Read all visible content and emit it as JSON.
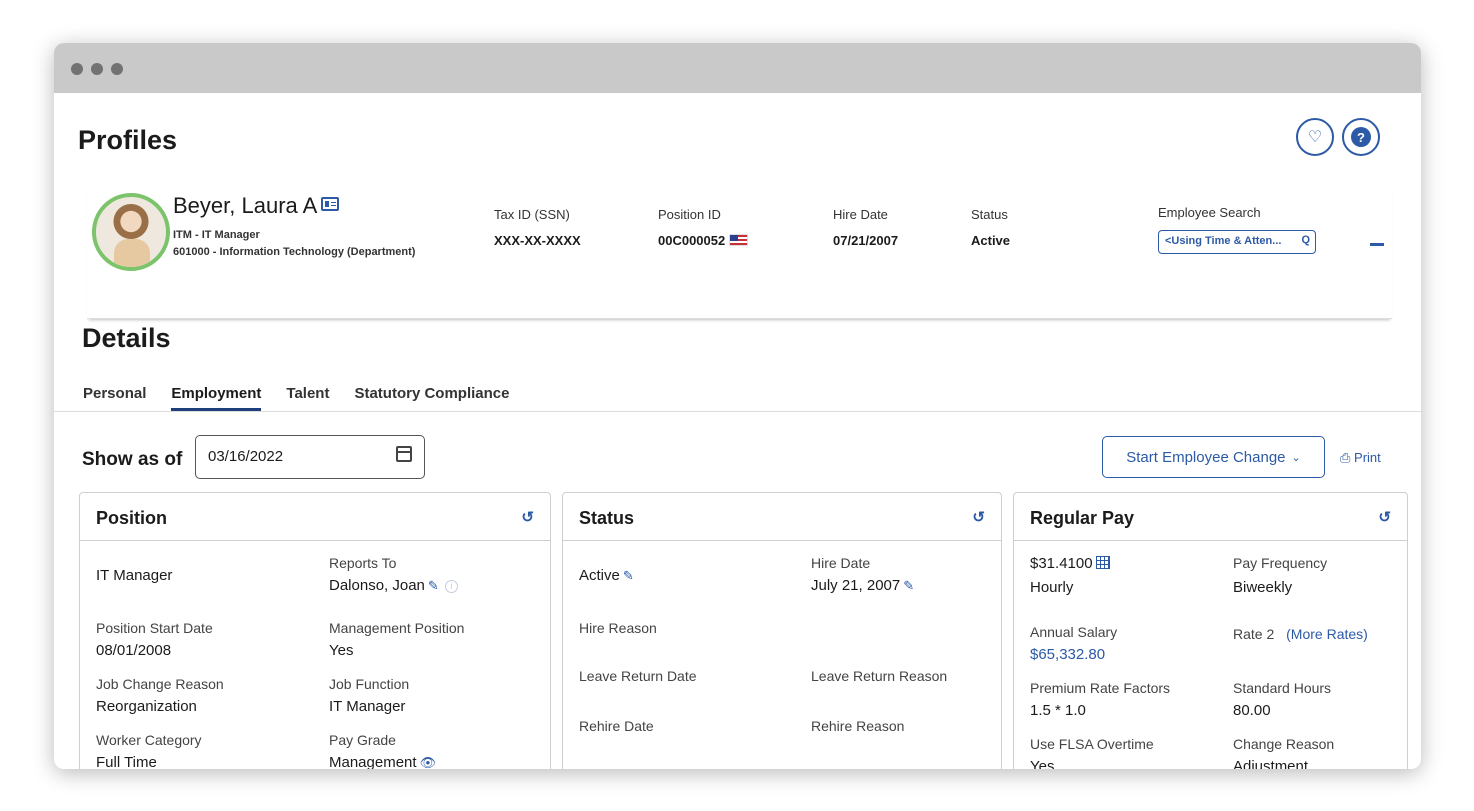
{
  "page": {
    "title": "Profiles",
    "details_title": "Details"
  },
  "employee": {
    "name": "Beyer, Laura A",
    "job": "ITM - IT Manager",
    "department": "601000 - Information Technology (Department)",
    "tax_id_label": "Tax ID (SSN)",
    "tax_id_value": "XXX-XX-XXXX",
    "position_id_label": "Position ID",
    "position_id_value": "00C000052",
    "hire_date_label": "Hire Date",
    "hire_date_value": "07/21/2007",
    "status_label": "Status",
    "status_value": "Active",
    "search_label": "Employee Search",
    "search_value": "<Using Time & Atten..."
  },
  "tabs": [
    {
      "label": "Personal"
    },
    {
      "label": "Employment"
    },
    {
      "label": "Talent"
    },
    {
      "label": "Statutory Compliance"
    }
  ],
  "controls": {
    "show_as_of_label": "Show as of",
    "show_as_of_value": "03/16/2022",
    "start_change_label": "Start Employee Change",
    "print_label": "Print"
  },
  "position": {
    "title": "Position",
    "job_title": "IT Manager",
    "reports_to_label": "Reports To",
    "reports_to_value": "Dalonso, Joan",
    "start_date_label": "Position Start Date",
    "start_date_value": "08/01/2008",
    "mgmt_label": "Management Position",
    "mgmt_value": "Yes",
    "job_change_label": "Job Change Reason",
    "job_change_value": "Reorganization",
    "job_function_label": "Job Function",
    "job_function_value": "IT Manager",
    "worker_cat_label": "Worker Category",
    "worker_cat_value": "Full Time",
    "pay_grade_label": "Pay Grade",
    "pay_grade_value": "Management"
  },
  "status": {
    "title": "Status",
    "value": "Active",
    "hire_date_label": "Hire Date",
    "hire_date_value": "July 21, 2007",
    "hire_reason_label": "Hire Reason",
    "leave_return_date_label": "Leave Return Date",
    "leave_return_reason_label": "Leave Return Reason",
    "rehire_date_label": "Rehire Date",
    "rehire_reason_label": "Rehire Reason"
  },
  "regular_pay": {
    "title": "Regular Pay",
    "rate_value": "$31.4100",
    "rate_type": "Hourly",
    "pay_freq_label": "Pay Frequency",
    "pay_freq_value": "Biweekly",
    "annual_salary_label": "Annual Salary",
    "annual_salary_value": "$65,332.80",
    "rate2_label": "Rate 2",
    "more_rates_label": "(More Rates)",
    "premium_label": "Premium Rate Factors",
    "premium_value": "1.5 * 1.0",
    "std_hours_label": "Standard Hours",
    "std_hours_value": "80.00",
    "flsa_label": "Use FLSA Overtime",
    "flsa_value": "Yes",
    "change_reason_label": "Change Reason",
    "change_reason_value": "Adjustment"
  },
  "colors": {
    "accent": "#2c5aa6",
    "avatar_ring": "#7cc46b",
    "titlebar": "#c9c9c9"
  }
}
